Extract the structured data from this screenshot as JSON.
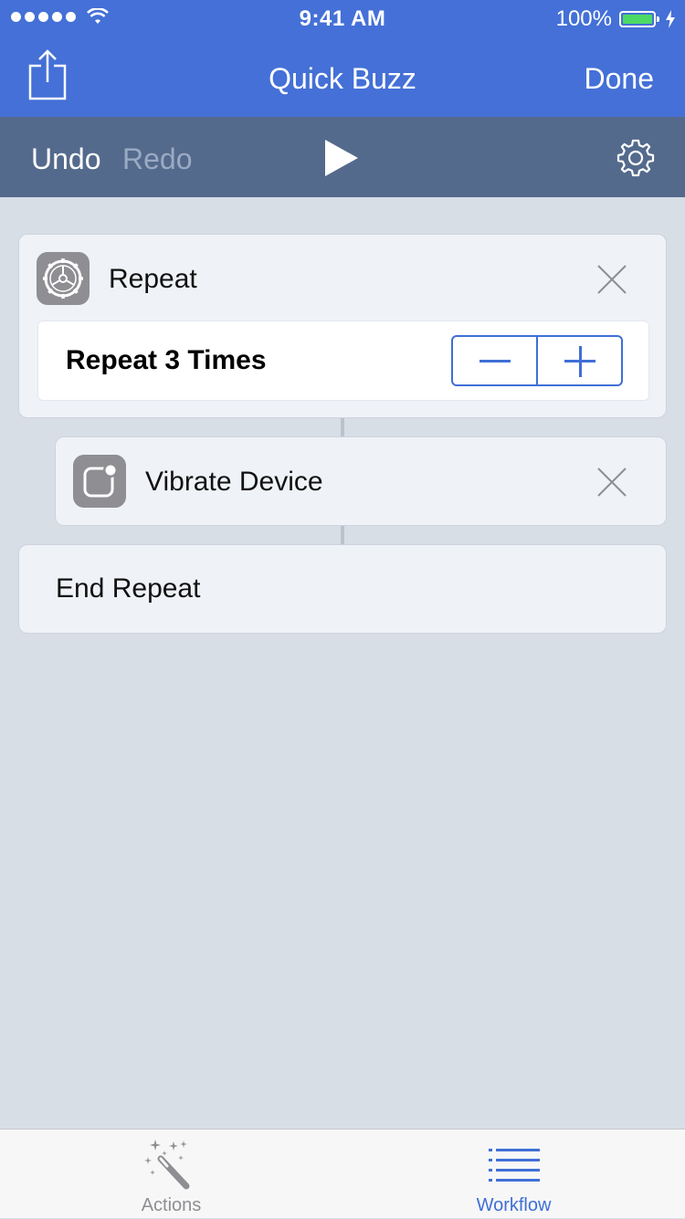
{
  "status_bar": {
    "time": "9:41 AM",
    "battery_percent": "100%",
    "signal_bars": 5,
    "icons": [
      "signal-dots-icon",
      "wifi-icon",
      "battery-icon",
      "charging-bolt-icon"
    ]
  },
  "nav": {
    "title": "Quick Buzz",
    "done_label": "Done",
    "share_icon": "share-icon"
  },
  "toolbar": {
    "undo_label": "Undo",
    "redo_label": "Redo",
    "play_icon": "play-icon",
    "settings_icon": "gear-icon"
  },
  "workflow": {
    "repeat": {
      "title": "Repeat",
      "icon": "settings-gear-icon",
      "param_label": "Repeat 3 Times",
      "count": 3
    },
    "vibrate": {
      "title": "Vibrate Device",
      "icon": "notification-badge-icon"
    },
    "end": {
      "title": "End Repeat"
    }
  },
  "tabs": [
    {
      "label": "Actions",
      "icon": "magic-wand-icon",
      "selected": false
    },
    {
      "label": "Workflow",
      "icon": "list-icon",
      "selected": true
    }
  ],
  "colors": {
    "accent": "#4470d7",
    "toolbar": "#546a8c",
    "background": "#d8dee6",
    "battery_fill": "#4cd964",
    "stepper": "#3f6fd6"
  }
}
